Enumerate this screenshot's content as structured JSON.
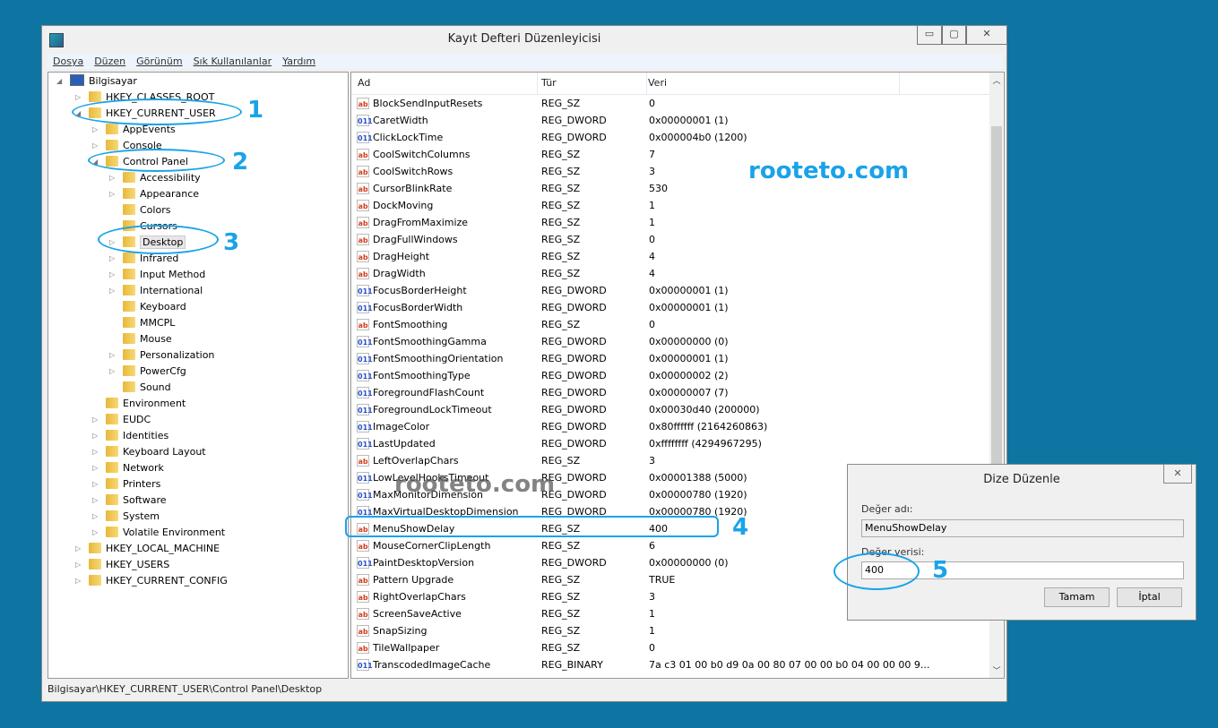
{
  "window": {
    "title": "Kayıt Defteri Düzenleyicisi",
    "minimize": "▭",
    "maximize": "▢",
    "close": "✕"
  },
  "menu": [
    "Dosya",
    "Düzen",
    "Görünüm",
    "Sık Kullanılanlar",
    "Yardım"
  ],
  "tree": [
    {
      "label": "Bilgisayar",
      "level": 0,
      "exp": "◢"
    },
    {
      "label": "HKEY_CLASSES_ROOT",
      "level": 1,
      "exp": "▷"
    },
    {
      "label": "HKEY_CURRENT_USER",
      "level": 1,
      "exp": "◢"
    },
    {
      "label": "AppEvents",
      "level": 2,
      "exp": "▷"
    },
    {
      "label": "Console",
      "level": 2,
      "exp": "▷"
    },
    {
      "label": "Control Panel",
      "level": 2,
      "exp": "◢"
    },
    {
      "label": "Accessibility",
      "level": 3,
      "exp": "▷"
    },
    {
      "label": "Appearance",
      "level": 3,
      "exp": "▷"
    },
    {
      "label": "Colors",
      "level": 3,
      "exp": ""
    },
    {
      "label": "Cursors",
      "level": 3,
      "exp": ""
    },
    {
      "label": "Desktop",
      "level": 3,
      "exp": "▷",
      "selected": true
    },
    {
      "label": "Infrared",
      "level": 3,
      "exp": "▷"
    },
    {
      "label": "Input Method",
      "level": 3,
      "exp": "▷"
    },
    {
      "label": "International",
      "level": 3,
      "exp": "▷"
    },
    {
      "label": "Keyboard",
      "level": 3,
      "exp": ""
    },
    {
      "label": "MMCPL",
      "level": 3,
      "exp": ""
    },
    {
      "label": "Mouse",
      "level": 3,
      "exp": ""
    },
    {
      "label": "Personalization",
      "level": 3,
      "exp": "▷"
    },
    {
      "label": "PowerCfg",
      "level": 3,
      "exp": "▷"
    },
    {
      "label": "Sound",
      "level": 3,
      "exp": ""
    },
    {
      "label": "Environment",
      "level": 2,
      "exp": ""
    },
    {
      "label": "EUDC",
      "level": 2,
      "exp": "▷"
    },
    {
      "label": "Identities",
      "level": 2,
      "exp": "▷"
    },
    {
      "label": "Keyboard Layout",
      "level": 2,
      "exp": "▷"
    },
    {
      "label": "Network",
      "level": 2,
      "exp": "▷"
    },
    {
      "label": "Printers",
      "level": 2,
      "exp": "▷"
    },
    {
      "label": "Software",
      "level": 2,
      "exp": "▷"
    },
    {
      "label": "System",
      "level": 2,
      "exp": "▷"
    },
    {
      "label": "Volatile Environment",
      "level": 2,
      "exp": "▷"
    },
    {
      "label": "HKEY_LOCAL_MACHINE",
      "level": 1,
      "exp": "▷"
    },
    {
      "label": "HKEY_USERS",
      "level": 1,
      "exp": "▷"
    },
    {
      "label": "HKEY_CURRENT_CONFIG",
      "level": 1,
      "exp": "▷"
    }
  ],
  "columns": [
    "Ad",
    "Tür",
    "Veri"
  ],
  "values": [
    [
      "BlockSendInputResets",
      "REG_SZ",
      "0"
    ],
    [
      "CaretWidth",
      "REG_DWORD",
      "0x00000001 (1)"
    ],
    [
      "ClickLockTime",
      "REG_DWORD",
      "0x000004b0 (1200)"
    ],
    [
      "CoolSwitchColumns",
      "REG_SZ",
      "7"
    ],
    [
      "CoolSwitchRows",
      "REG_SZ",
      "3"
    ],
    [
      "CursorBlinkRate",
      "REG_SZ",
      "530"
    ],
    [
      "DockMoving",
      "REG_SZ",
      "1"
    ],
    [
      "DragFromMaximize",
      "REG_SZ",
      "1"
    ],
    [
      "DragFullWindows",
      "REG_SZ",
      "0"
    ],
    [
      "DragHeight",
      "REG_SZ",
      "4"
    ],
    [
      "DragWidth",
      "REG_SZ",
      "4"
    ],
    [
      "FocusBorderHeight",
      "REG_DWORD",
      "0x00000001 (1)"
    ],
    [
      "FocusBorderWidth",
      "REG_DWORD",
      "0x00000001 (1)"
    ],
    [
      "FontSmoothing",
      "REG_SZ",
      "0"
    ],
    [
      "FontSmoothingGamma",
      "REG_DWORD",
      "0x00000000 (0)"
    ],
    [
      "FontSmoothingOrientation",
      "REG_DWORD",
      "0x00000001 (1)"
    ],
    [
      "FontSmoothingType",
      "REG_DWORD",
      "0x00000002 (2)"
    ],
    [
      "ForegroundFlashCount",
      "REG_DWORD",
      "0x00000007 (7)"
    ],
    [
      "ForegroundLockTimeout",
      "REG_DWORD",
      "0x00030d40 (200000)"
    ],
    [
      "ImageColor",
      "REG_DWORD",
      "0x80ffffff (2164260863)"
    ],
    [
      "LastUpdated",
      "REG_DWORD",
      "0xffffffff (4294967295)"
    ],
    [
      "LeftOverlapChars",
      "REG_SZ",
      "3"
    ],
    [
      "LowLevelHooksTimeout",
      "REG_DWORD",
      "0x00001388 (5000)"
    ],
    [
      "MaxMonitorDimension",
      "REG_DWORD",
      "0x00000780 (1920)"
    ],
    [
      "MaxVirtualDesktopDimension",
      "REG_DWORD",
      "0x00000780 (1920)"
    ],
    [
      "MenuShowDelay",
      "REG_SZ",
      "400"
    ],
    [
      "MouseCornerClipLength",
      "REG_SZ",
      "6"
    ],
    [
      "PaintDesktopVersion",
      "REG_DWORD",
      "0x00000000 (0)"
    ],
    [
      "Pattern Upgrade",
      "REG_SZ",
      "TRUE"
    ],
    [
      "RightOverlapChars",
      "REG_SZ",
      "3"
    ],
    [
      "ScreenSaveActive",
      "REG_SZ",
      "1"
    ],
    [
      "SnapSizing",
      "REG_SZ",
      "1"
    ],
    [
      "TileWallpaper",
      "REG_SZ",
      "0"
    ],
    [
      "TranscodedImageCache",
      "REG_BINARY",
      "7a c3 01 00 b0 d9 0a 00 80 07 00 00 b0 04 00 00 00 9..."
    ]
  ],
  "status": "Bilgisayar\\HKEY_CURRENT_USER\\Control Panel\\Desktop",
  "dialog": {
    "title": "Dize Düzenle",
    "close": "✕",
    "name_label": "Değer adı:",
    "name_value": "MenuShowDelay",
    "data_label": "Değer verisi:",
    "data_value": "400",
    "ok": "Tamam",
    "cancel": "İptal"
  },
  "annotations": [
    "1",
    "2",
    "3",
    "4",
    "5"
  ],
  "watermark": "rooteto.com",
  "colors": {
    "annotation": "#1aa3e8",
    "desktop": "#0e74a2",
    "string_icon": "#d13f1f",
    "binary_icon": "#2850c8"
  }
}
